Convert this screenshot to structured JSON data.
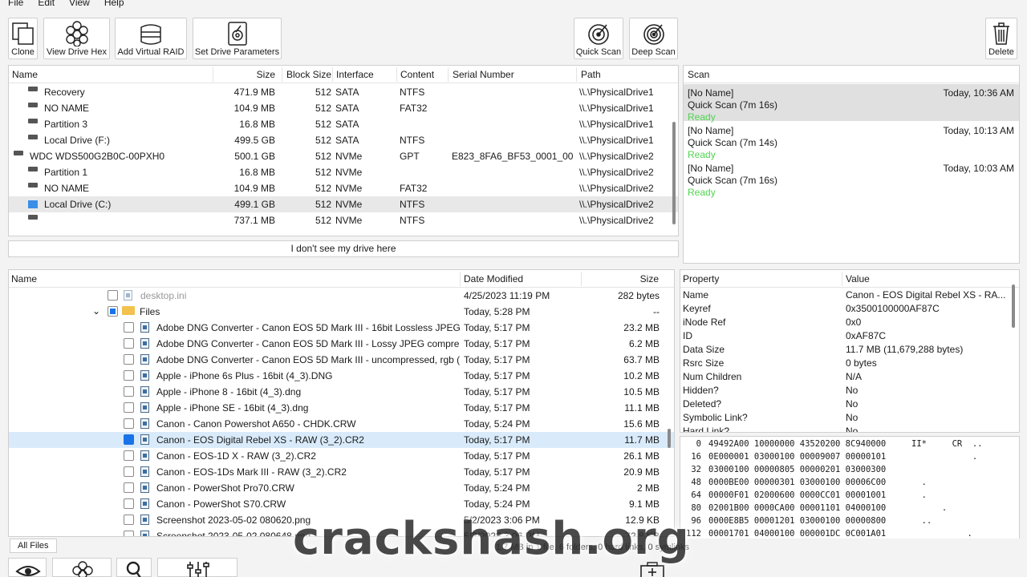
{
  "menu": [
    "File",
    "Edit",
    "View",
    "Help"
  ],
  "toolbar": {
    "clone": "Clone",
    "view_hex": "View Drive Hex",
    "add_raid": "Add Virtual RAID",
    "set_params": "Set Drive Parameters",
    "quick_scan": "Quick Scan",
    "deep_scan": "Deep Scan",
    "delete": "Delete"
  },
  "drives": {
    "headers": [
      "Name",
      "Size",
      "Block Size",
      "Interface",
      "Content",
      "Serial Number",
      "Path"
    ],
    "rows": [
      {
        "name": "Recovery",
        "size": "471.9 MB",
        "block": "512",
        "iface": "SATA",
        "content": "NTFS",
        "serial": "",
        "path": "\\\\.\\PhysicalDrive1"
      },
      {
        "name": "NO NAME",
        "size": "104.9 MB",
        "block": "512",
        "iface": "SATA",
        "content": "FAT32",
        "serial": "",
        "path": "\\\\.\\PhysicalDrive1"
      },
      {
        "name": "Partition 3",
        "size": "16.8 MB",
        "block": "512",
        "iface": "SATA",
        "content": "",
        "serial": "",
        "path": "\\\\.\\PhysicalDrive1"
      },
      {
        "name": "Local Drive (F:)",
        "size": "499.5 GB",
        "block": "512",
        "iface": "SATA",
        "content": "NTFS",
        "serial": "",
        "path": "\\\\.\\PhysicalDrive1"
      },
      {
        "name": "WDC WDS500G2B0C-00PXH0",
        "size": "500.1 GB",
        "block": "512",
        "iface": "NVMe",
        "content": "GPT",
        "serial": "E823_8FA6_BF53_0001_001B...",
        "path": "\\\\.\\PhysicalDrive2"
      },
      {
        "name": "Partition 1",
        "size": "16.8 MB",
        "block": "512",
        "iface": "NVMe",
        "content": "",
        "serial": "",
        "path": "\\\\.\\PhysicalDrive2"
      },
      {
        "name": "NO NAME",
        "size": "104.9 MB",
        "block": "512",
        "iface": "NVMe",
        "content": "FAT32",
        "serial": "",
        "path": "\\\\.\\PhysicalDrive2"
      },
      {
        "name": "Local Drive (C:)",
        "size": "499.1 GB",
        "block": "512",
        "iface": "NVMe",
        "content": "NTFS",
        "serial": "",
        "path": "\\\\.\\PhysicalDrive2"
      },
      {
        "name": "",
        "size": "737.1 MB",
        "block": "512",
        "iface": "NVMe",
        "content": "NTFS",
        "serial": "",
        "path": "\\\\.\\PhysicalDrive2"
      }
    ],
    "missing_button": "I don't see my drive here"
  },
  "scan": {
    "header": "Scan",
    "items": [
      {
        "name": "[No Name]",
        "time": "Today, 10:36 AM",
        "type": "Quick Scan (7m 16s)",
        "status": "Ready"
      },
      {
        "name": "[No Name]",
        "time": "Today, 10:13 AM",
        "type": "Quick Scan (7m 14s)",
        "status": "Ready"
      },
      {
        "name": "[No Name]",
        "time": "Today, 10:03 AM",
        "type": "Quick Scan (7m 16s)",
        "status": "Ready"
      }
    ]
  },
  "files": {
    "headers": [
      "Name",
      "Date Modified",
      "Size"
    ],
    "rows": [
      {
        "name": "desktop.ini",
        "date": "4/25/2023 11:19 PM",
        "size": "282 bytes"
      },
      {
        "name": "Files",
        "date": "Today, 5:28 PM",
        "size": "--"
      },
      {
        "name": "Adobe DNG Converter - Canon EOS 5D Mark III - 16bit Lossless JPEG c...",
        "date": "Today, 5:17 PM",
        "size": "23.2 MB"
      },
      {
        "name": "Adobe DNG Converter - Canon EOS 5D Mark III - Lossy JPEG compres...",
        "date": "Today, 5:17 PM",
        "size": "6.2 MB"
      },
      {
        "name": "Adobe DNG Converter - Canon EOS 5D Mark III - uncompressed, rgb (...",
        "date": "Today, 5:17 PM",
        "size": "63.7 MB"
      },
      {
        "name": "Apple - iPhone 6s Plus - 16bit (4_3).DNG",
        "date": "Today, 5:17 PM",
        "size": "10.2 MB"
      },
      {
        "name": "Apple - iPhone 8 - 16bit (4_3).dng",
        "date": "Today, 5:17 PM",
        "size": "10.5 MB"
      },
      {
        "name": "Apple - iPhone SE - 16bit (4_3).dng",
        "date": "Today, 5:17 PM",
        "size": "11.1 MB"
      },
      {
        "name": "Canon - Canon Powershot A650 - CHDK.CRW",
        "date": "Today, 5:24 PM",
        "size": "15.6 MB"
      },
      {
        "name": "Canon - EOS Digital Rebel XS - RAW (3_2).CR2",
        "date": "Today, 5:17 PM",
        "size": "11.7 MB"
      },
      {
        "name": "Canon - EOS-1D X - RAW (3_2).CR2",
        "date": "Today, 5:17 PM",
        "size": "26.1 MB"
      },
      {
        "name": "Canon - EOS-1Ds Mark III - RAW (3_2).CR2",
        "date": "Today, 5:17 PM",
        "size": "20.9 MB"
      },
      {
        "name": "Canon - PowerShot Pro70.CRW",
        "date": "Today, 5:24 PM",
        "size": "2 MB"
      },
      {
        "name": "Canon - PowerShot S70.CRW",
        "date": "Today, 5:24 PM",
        "size": "9.1 MB"
      },
      {
        "name": "Screenshot 2023-05-02 080620.png",
        "date": "5/2/2023 3:06 PM",
        "size": "12.9 KB"
      },
      {
        "name": "Screenshot 2023-05-02 080648.png",
        "date": "5/2/2023 3:06 PM",
        "size": "72.8 KB"
      }
    ]
  },
  "props": {
    "headers": [
      "Property",
      "Value"
    ],
    "rows": [
      {
        "k": "Name",
        "v": "Canon - EOS Digital Rebel XS - RA..."
      },
      {
        "k": "Keyref",
        "v": "0x3500100000AF87C"
      },
      {
        "k": "iNode Ref",
        "v": "0x0"
      },
      {
        "k": "ID",
        "v": "0xAF87C"
      },
      {
        "k": "Data Size",
        "v": "11.7 MB (11,679,288 bytes)"
      },
      {
        "k": "Rsrc Size",
        "v": "0 bytes"
      },
      {
        "k": "Num Children",
        "v": "N/A"
      },
      {
        "k": "Hidden?",
        "v": "No"
      },
      {
        "k": "Deleted?",
        "v": "No"
      },
      {
        "k": "Symbolic Link?",
        "v": "No"
      },
      {
        "k": "Hard Link?",
        "v": "No"
      }
    ]
  },
  "hex": [
    {
      "off": "0",
      "bytes": "49492A00 10000000 43520200 8C940000",
      "ascii": "II*     CR  .."
    },
    {
      "off": "16",
      "bytes": "0E000001 03000100 00009007 00000101",
      "ascii": "            ."
    },
    {
      "off": "32",
      "bytes": "03000100 00000805 00000201 03000300",
      "ascii": ""
    },
    {
      "off": "48",
      "bytes": "0000BE00 00000301 03000100 00006C00",
      "ascii": "  ."
    },
    {
      "off": "64",
      "bytes": "00000F01 02000600 0000CC01 00001001",
      "ascii": "  ."
    },
    {
      "off": "80",
      "bytes": "02001B00 0000CA00 00001101 04000100",
      "ascii": "      ."
    },
    {
      "off": "96",
      "bytes": "0000E8B5 00001201 03000100 00000800",
      "ascii": "  .."
    },
    {
      "off": "112",
      "bytes": "00001701 04000100 000001DC 0C001A01",
      "ascii": "           ."
    },
    {
      "off": "128",
      "bytes": "05000100 0000EA00 00001B01 05000100",
      "ascii": ""
    },
    {
      "off": "144",
      "bytes": "0000F200 00002801 03000100 00000200",
      "ascii": "  .   ("
    },
    {
      "off": "160",
      "bytes": "00003201 02001400 0000FA00 00006987",
      "ascii": "2        i."
    }
  ],
  "status": {
    "tab": "All Files",
    "summary": "1.7 MB in 1 file, 6 folders, 0 hard links, 0 symlinks"
  },
  "watermark": "crackshash.org"
}
